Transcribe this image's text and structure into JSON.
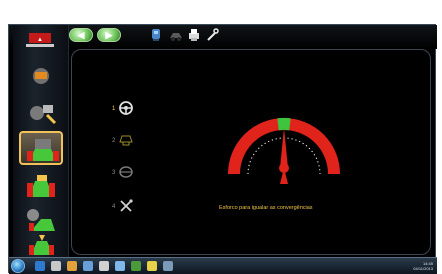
{
  "toolbar": {
    "nav": [
      {
        "name": "back-button",
        "icon": "arrow-left-icon"
      },
      {
        "name": "forward-button",
        "icon": "arrow-right-icon"
      }
    ],
    "tools": [
      {
        "name": "alignment-tool-1",
        "icon": "machine-icon"
      },
      {
        "name": "alignment-tool-2",
        "icon": "car-icon"
      },
      {
        "name": "alignment-tool-3",
        "icon": "printer-icon"
      },
      {
        "name": "alignment-tool-4",
        "icon": "wrench-icon"
      }
    ]
  },
  "sidebar": {
    "items": [
      {
        "name": "sidebar-item-1"
      },
      {
        "name": "sidebar-item-2"
      },
      {
        "name": "sidebar-item-3",
        "active": true
      },
      {
        "name": "sidebar-item-4"
      },
      {
        "name": "sidebar-item-5"
      },
      {
        "name": "sidebar-item-6"
      }
    ]
  },
  "steps": [
    {
      "label": "1",
      "icon": "steering-wheel-icon",
      "active": true
    },
    {
      "label": "2",
      "icon": "lift-icon",
      "active": false
    },
    {
      "label": "3",
      "icon": "steering-wheel-icon",
      "active": false
    },
    {
      "label": "4",
      "icon": "wrench-screwdriver-icon",
      "active": false
    }
  ],
  "gauge": {
    "status_text": "Esforco para igualar as convergências",
    "needle_fraction": 0.5,
    "colors": {
      "red": "#e0231b",
      "green": "#3ec43e"
    }
  },
  "taskbar": {
    "clock_line1": "14:45",
    "clock_line2": "04/11/2013"
  }
}
